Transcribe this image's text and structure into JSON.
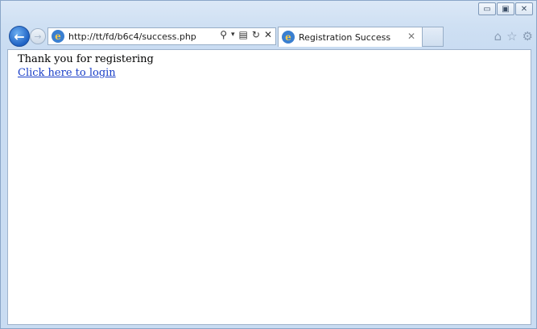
{
  "browser": {
    "address_url": "http://tt/fd/b6c4/success.php",
    "tab_title": "Registration Success",
    "caption": {
      "minimize": "▭",
      "restore": "▣",
      "close": "✕"
    },
    "icons": {
      "back": "back-arrow-icon",
      "forward": "forward-arrow-icon",
      "search": "search-icon",
      "dropdown": "chevron-down-icon",
      "compat": "compat-view-icon",
      "refresh": "refresh-icon",
      "stop": "stop-icon",
      "home": "home-icon",
      "favorites": "favorites-star-icon",
      "tools": "gear-icon"
    }
  },
  "page": {
    "message": "Thank you for registering",
    "login_link": "Click here to login"
  }
}
